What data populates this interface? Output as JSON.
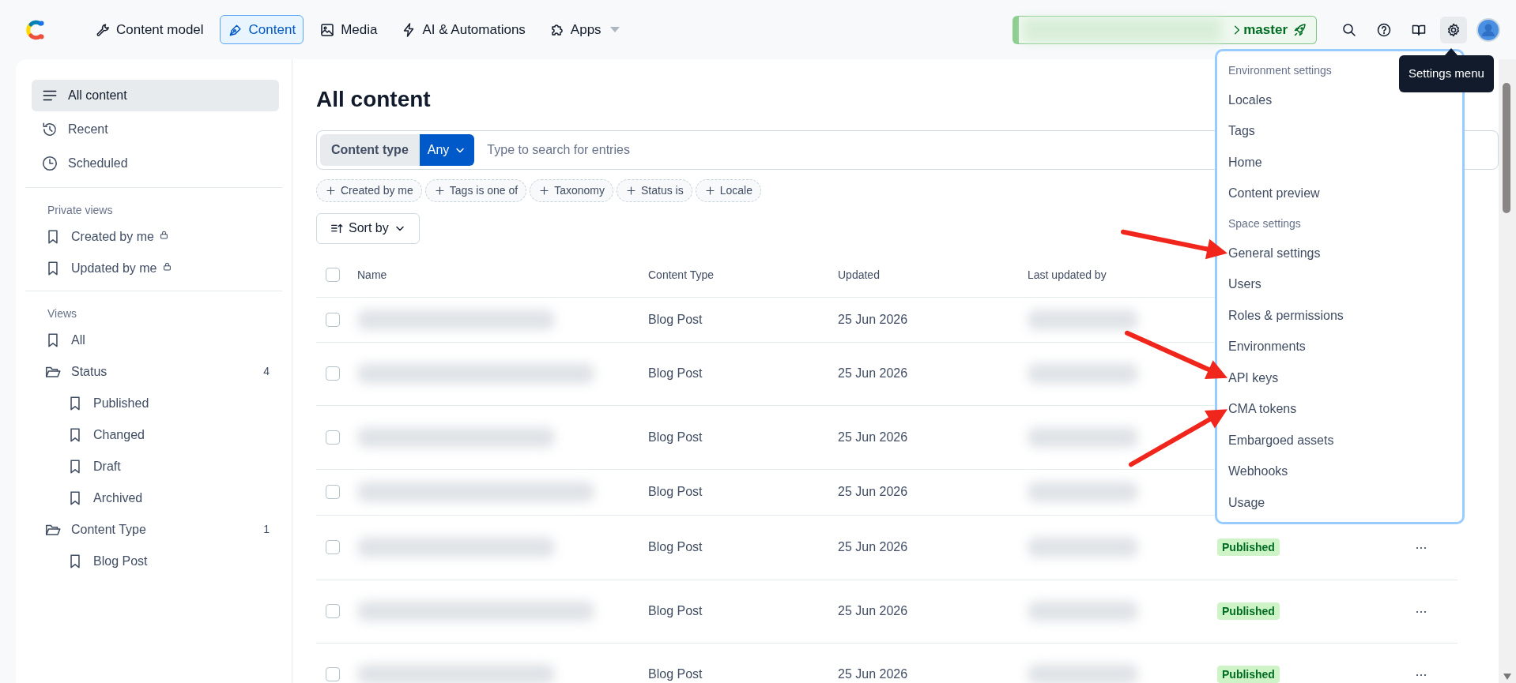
{
  "nav": [
    {
      "label": "Content model",
      "selected": false
    },
    {
      "label": "Content",
      "selected": true
    },
    {
      "label": "Media",
      "selected": false
    },
    {
      "label": "AI & Automations",
      "selected": false
    },
    {
      "label": "Apps",
      "selected": false,
      "dropdown": true
    }
  ],
  "environment": {
    "name": "master",
    "blurred": true
  },
  "tooltip": "Settings menu",
  "sidebar": {
    "items": [
      {
        "label": "All content",
        "selected": true
      },
      {
        "label": "Recent",
        "selected": false
      },
      {
        "label": "Scheduled",
        "selected": false
      }
    ],
    "sections": [
      {
        "title": "Private views",
        "items": [
          {
            "label": "Created by me",
            "kind": "view",
            "locked": true,
            "selected": false
          },
          {
            "label": "Updated by me",
            "kind": "view",
            "locked": true,
            "selected": false
          }
        ]
      },
      {
        "title": "Views",
        "items": [
          {
            "label": "All",
            "kind": "view",
            "selected": false
          },
          {
            "label": "Status",
            "kind": "folder",
            "count": "4",
            "selected": false,
            "children": [
              {
                "label": "Published",
                "kind": "view",
                "selected": false
              },
              {
                "label": "Changed",
                "kind": "view",
                "selected": false
              },
              {
                "label": "Draft",
                "kind": "view",
                "selected": false
              },
              {
                "label": "Archived",
                "kind": "view",
                "selected": false
              }
            ]
          },
          {
            "label": "Content Type",
            "kind": "folder",
            "count": "1",
            "selected": false,
            "children": [
              {
                "label": "Blog Post",
                "kind": "view",
                "selected": false
              }
            ]
          }
        ]
      }
    ]
  },
  "main": {
    "title": "All content",
    "search": {
      "filter_label": "Content type",
      "filter_value": "Any",
      "placeholder": "Type to search for entries"
    },
    "filters": [
      "Created by me",
      "Tags is one of",
      "Taxonomy",
      "Status is",
      "Locale"
    ],
    "sort_button": "Sort by",
    "table": {
      "select_all_checked": false,
      "columns": [
        "Name",
        "Content Type",
        "Updated",
        "Last updated by"
      ],
      "rows": [
        {
          "checked": false,
          "name_blurred": true,
          "content_type": "Blog Post",
          "updated": "25 Jun 2026",
          "updated_by_blurred": true
        },
        {
          "checked": false,
          "name_blurred": true,
          "content_type": "Blog Post",
          "updated": "25 Jun 2026",
          "updated_by_blurred": true
        },
        {
          "checked": false,
          "name_blurred": true,
          "content_type": "Blog Post",
          "updated": "25 Jun 2026",
          "updated_by_blurred": true
        },
        {
          "checked": false,
          "name_blurred": true,
          "content_type": "Blog Post",
          "updated": "25 Jun 2026",
          "updated_by_blurred": true
        },
        {
          "checked": false,
          "name_blurred": true,
          "content_type": "Blog Post",
          "updated": "25 Jun 2026",
          "updated_by_blurred": true,
          "status": "Published",
          "actions": "···"
        },
        {
          "checked": false,
          "name_blurred": true,
          "content_type": "Blog Post",
          "updated": "25 Jun 2026",
          "updated_by_blurred": true,
          "status": "Published",
          "actions": "···"
        },
        {
          "checked": false,
          "name_blurred": true,
          "content_type": "Blog Post",
          "updated": "25 Jun 2026",
          "updated_by_blurred": true,
          "status": "Published",
          "actions": "···"
        }
      ]
    }
  },
  "settings_menu": {
    "groups": [
      {
        "title": "Environment settings",
        "items": [
          {
            "label": "Locales"
          },
          {
            "label": "Tags"
          },
          {
            "label": "Home"
          },
          {
            "label": "Content preview"
          }
        ]
      },
      {
        "title": "Space settings",
        "items": [
          {
            "label": "General settings",
            "annotated": true
          },
          {
            "label": "Users"
          },
          {
            "label": "Roles & permissions"
          },
          {
            "label": "Environments"
          },
          {
            "label": "API keys",
            "annotated": true
          },
          {
            "label": "CMA tokens",
            "annotated": true
          },
          {
            "label": "Embargoed assets"
          },
          {
            "label": "Webhooks"
          },
          {
            "label": "Usage"
          }
        ]
      }
    ]
  }
}
